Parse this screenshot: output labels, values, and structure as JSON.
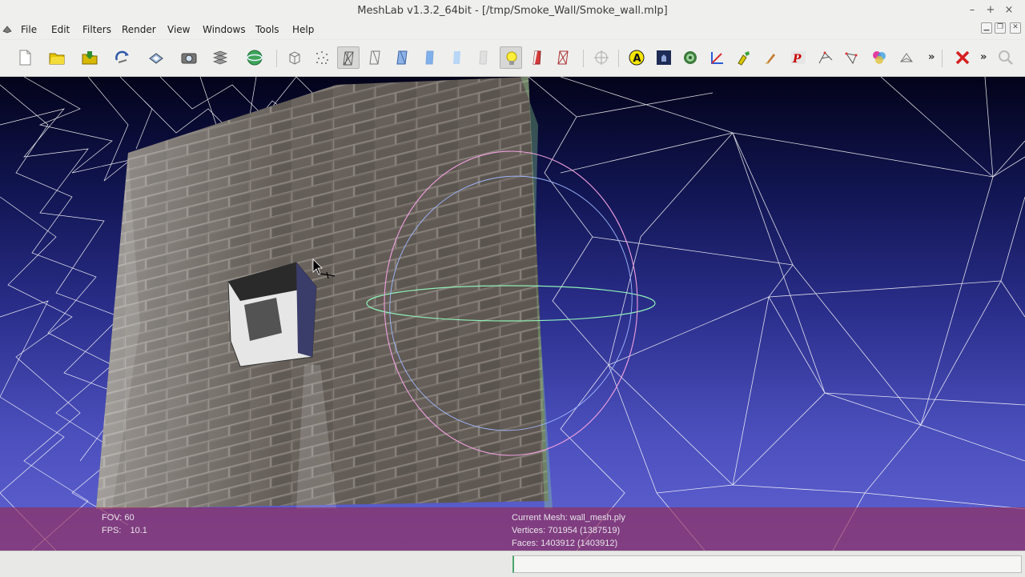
{
  "window": {
    "title": "MeshLab v1.3.2_64bit - [/tmp/Smoke_Wall/Smoke_wall.mlp]",
    "controls": [
      "–",
      "+",
      "×"
    ]
  },
  "menu": {
    "items": [
      "File",
      "Edit",
      "Filters",
      "Render",
      "View",
      "Windows",
      "Tools",
      "Help"
    ]
  },
  "toolbar": {
    "icons": [
      "new-document-icon",
      "open-folder-icon",
      "import-mesh-icon",
      "reload-icon",
      "save-icon",
      "snapshot-camera-icon",
      "layers-icon",
      "globe-icon",
      "bounding-box-icon",
      "points-icon",
      "wireframe-icon",
      "hidden-lines-icon",
      "flat-lines-icon",
      "flat-icon",
      "smooth-icon",
      "texture-icon",
      "light-bulb-icon",
      "double-side-lighting-icon",
      "backface-culling-icon",
      "manipulator-icon",
      "annotation-a-icon",
      "trackball-icon",
      "paint-selection-icon",
      "measure-axes-icon",
      "vertex-color-icon",
      "paint-brush-icon",
      "pick-points-icon",
      "align-icon",
      "select-vertices-icon",
      "z-painting-icon",
      "rgb-flower-icon",
      "select-connected-icon",
      "delete-selection-icon",
      "search-icon"
    ],
    "overflow_label": "»"
  },
  "viewport": {
    "fov_label": "FOV:",
    "fov_value": "60",
    "fps_label": "FPS:",
    "fps_value": "10.1",
    "current_mesh_label": "Current Mesh:",
    "current_mesh": "wall_mesh.ply",
    "vertices_label": "Vertices:",
    "vertices": "701954 (1387519)",
    "faces_label": "Faces:",
    "faces": "1403912 (1403912)"
  },
  "colors": {
    "background_top": "#03031a",
    "background_bottom": "#6063d2",
    "info_overlay": "#962850",
    "wireframe": "#ffffff",
    "wall": "#6b645d"
  }
}
